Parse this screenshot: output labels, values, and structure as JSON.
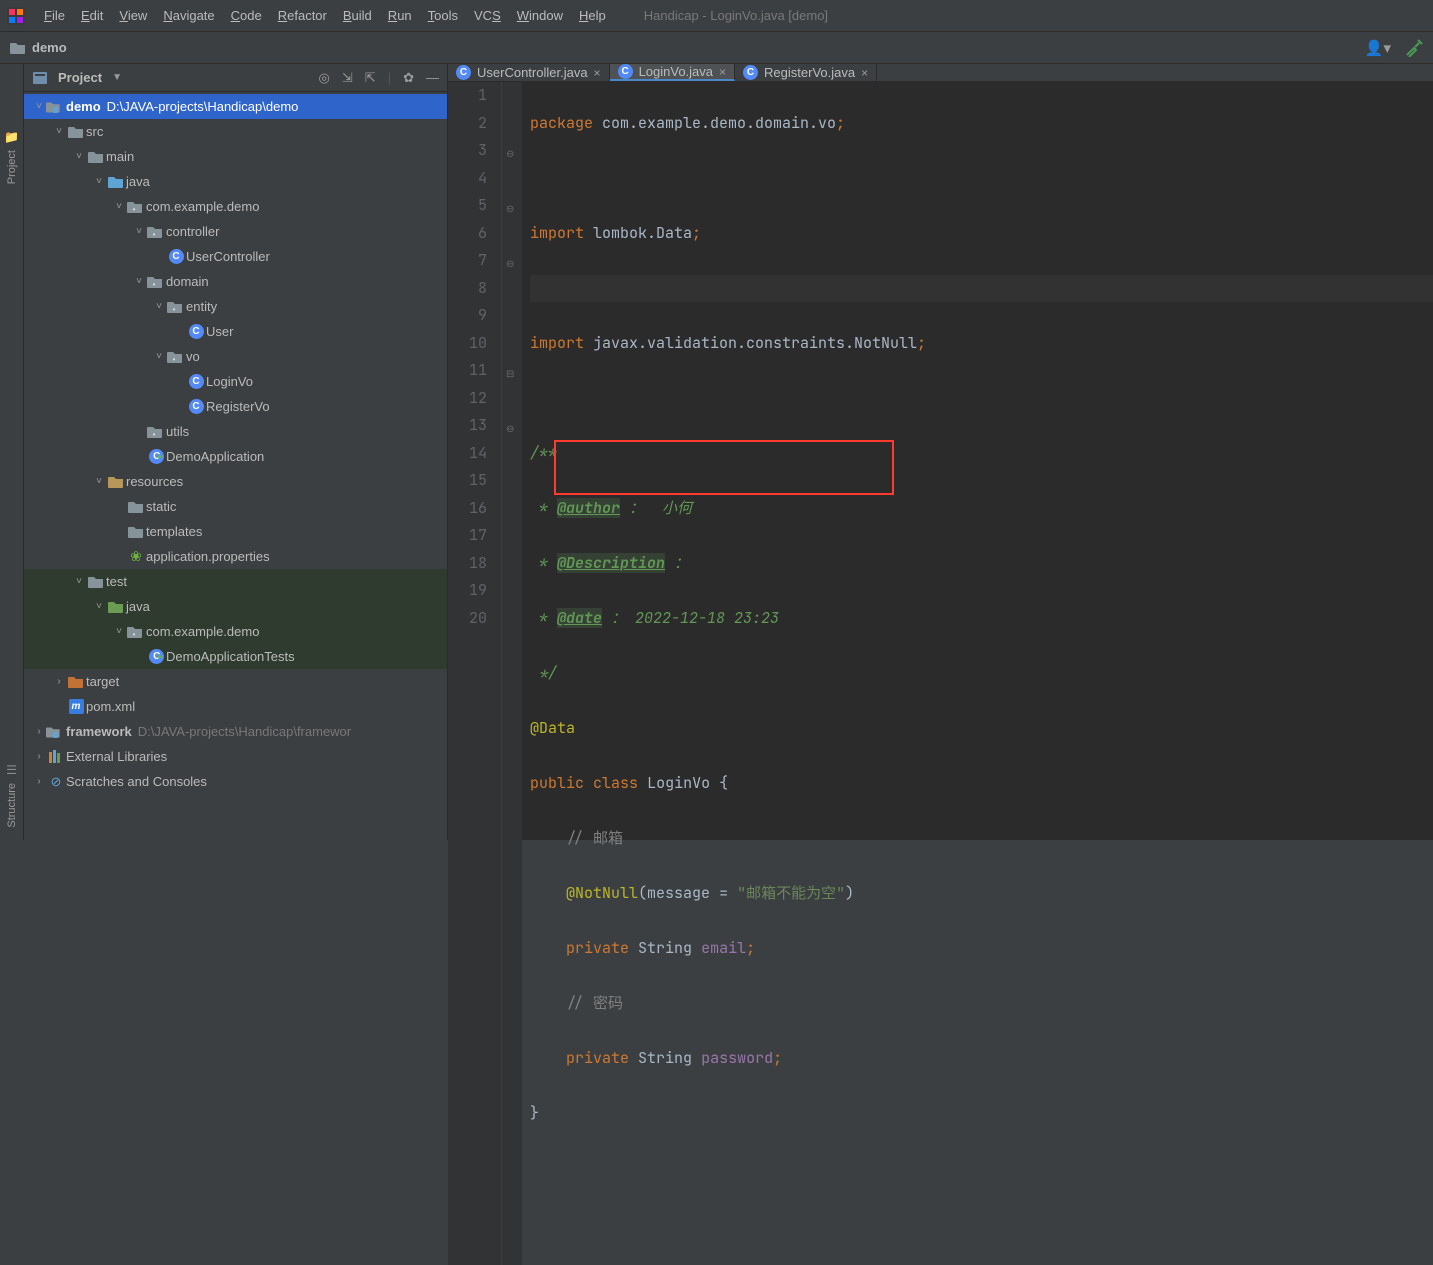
{
  "menubar": {
    "items": [
      {
        "mn": "F",
        "rest": "ile"
      },
      {
        "mn": "E",
        "rest": "dit"
      },
      {
        "mn": "V",
        "rest": "iew"
      },
      {
        "mn": "N",
        "rest": "avigate"
      },
      {
        "mn": "C",
        "rest": "ode"
      },
      {
        "mn": "R",
        "rest": "efactor"
      },
      {
        "mn": "B",
        "rest": "uild"
      },
      {
        "mn": "R",
        "rest": "un",
        "pre": "",
        "u": "u"
      },
      {
        "mn": "T",
        "rest": "ools"
      },
      {
        "mn": "S",
        "rest": "",
        "pre": "VC"
      },
      {
        "mn": "W",
        "rest": "indow"
      },
      {
        "mn": "H",
        "rest": "elp"
      }
    ],
    "window_title": "Handicap - LoginVo.java [demo]"
  },
  "breadcrumb": {
    "project": "demo"
  },
  "project_panel": {
    "selector_label": "Project",
    "tree": [
      {
        "indent": 0,
        "exp": "˅",
        "icon": "module",
        "label": "demo",
        "hint": "D:\\JAVA-projects\\Handicap\\demo",
        "selected": true
      },
      {
        "indent": 1,
        "exp": "˅",
        "icon": "folder",
        "label": "src"
      },
      {
        "indent": 2,
        "exp": "˅",
        "icon": "folder",
        "label": "main"
      },
      {
        "indent": 3,
        "exp": "˅",
        "icon": "srcfolder",
        "label": "java"
      },
      {
        "indent": 4,
        "exp": "˅",
        "icon": "package",
        "label": "com.example.demo"
      },
      {
        "indent": 5,
        "exp": "˅",
        "icon": "package",
        "label": "controller"
      },
      {
        "indent": 6,
        "exp": "",
        "icon": "class",
        "label": "UserController"
      },
      {
        "indent": 5,
        "exp": "˅",
        "icon": "package",
        "label": "domain"
      },
      {
        "indent": 6,
        "exp": "˅",
        "icon": "package",
        "label": "entity"
      },
      {
        "indent": 7,
        "exp": "",
        "icon": "class",
        "label": "User"
      },
      {
        "indent": 6,
        "exp": "˅",
        "icon": "package",
        "label": "vo"
      },
      {
        "indent": 7,
        "exp": "",
        "icon": "class",
        "label": "LoginVo"
      },
      {
        "indent": 7,
        "exp": "",
        "icon": "class",
        "label": "RegisterVo"
      },
      {
        "indent": 5,
        "exp": "",
        "icon": "package",
        "label": "utils"
      },
      {
        "indent": 5,
        "exp": "",
        "icon": "runclass",
        "label": "DemoApplication"
      },
      {
        "indent": 3,
        "exp": "˅",
        "icon": "resfolder",
        "label": "resources"
      },
      {
        "indent": 4,
        "exp": "",
        "icon": "folder",
        "label": "static"
      },
      {
        "indent": 4,
        "exp": "",
        "icon": "folder",
        "label": "templates"
      },
      {
        "indent": 4,
        "exp": "",
        "icon": "spring",
        "label": "application.properties"
      },
      {
        "indent": 2,
        "exp": "˅",
        "icon": "folder",
        "label": "test",
        "testhi": true
      },
      {
        "indent": 3,
        "exp": "˅",
        "icon": "testfolder",
        "label": "java",
        "testhi": true
      },
      {
        "indent": 4,
        "exp": "˅",
        "icon": "package",
        "label": "com.example.demo",
        "testhi": true
      },
      {
        "indent": 5,
        "exp": "",
        "icon": "runclass",
        "label": "DemoApplicationTests",
        "testhi": true
      },
      {
        "indent": 1,
        "exp": "›",
        "icon": "excluded",
        "label": "target"
      },
      {
        "indent": 1,
        "exp": "",
        "icon": "maven",
        "label": "pom.xml"
      },
      {
        "indent": 0,
        "exp": "›",
        "icon": "module",
        "label": "framework",
        "hint": "D:\\JAVA-projects\\Handicap\\framewor"
      },
      {
        "indent": 0,
        "exp": "›",
        "icon": "libs",
        "label": "External Libraries"
      },
      {
        "indent": 0,
        "exp": "›",
        "icon": "scratch",
        "label": "Scratches and Consoles"
      }
    ]
  },
  "tabs": [
    {
      "label": "UserController.java",
      "active": false
    },
    {
      "label": "LoginVo.java",
      "active": true
    },
    {
      "label": "RegisterVo.java",
      "active": false
    }
  ],
  "editor": {
    "line_numbers": [
      "1",
      "2",
      "3",
      "4",
      "5",
      "6",
      "7",
      "8",
      "9",
      "10",
      "11",
      "12",
      "13",
      "14",
      "15",
      "16",
      "17",
      "18",
      "19",
      "20"
    ],
    "code": {
      "l1_kw": "package",
      "l1_pkg": " com.example.demo.domain.vo",
      "l1_semi": ";",
      "l3_kw": "import",
      "l3_pkg": " lombok.Data",
      "l3_semi": ";",
      "l5_kw": "import",
      "l5_pkg": " javax.validation.constraints.NotNull",
      "l5_semi": ";",
      "l7_doc": "/**",
      "l8_pre": " * ",
      "l8_tag": "@author",
      "l8_rest": " ：  小何",
      "l9_pre": " * ",
      "l9_tag": "@Description",
      "l9_rest": " ：",
      "l10_pre": " * ",
      "l10_tag": "@date",
      "l10_rest": " ： 2022-12-18 23:23",
      "l11_doc": " */",
      "l12_ann": "@Data",
      "l13_kw1": "public",
      "l13_kw2": "class",
      "l13_name": "LoginVo",
      "l13_brace": " {",
      "l14_cmt": "// 邮箱",
      "l15_ann": "@NotNull",
      "l15_open": "(",
      "l15_param": "message",
      "l15_eq": " = ",
      "l15_str": "\"邮箱不能为空\"",
      "l15_close": ")",
      "l16_kw": "private",
      "l16_type": "String",
      "l16_name": "email",
      "l16_semi": ";",
      "l17_cmt": "// 密码",
      "l18_kw": "private",
      "l18_type": "String",
      "l18_name": "password",
      "l18_semi": ";",
      "l19_brace": "}"
    }
  },
  "left_rail": {
    "labels": [
      "Project",
      "Structure"
    ]
  }
}
